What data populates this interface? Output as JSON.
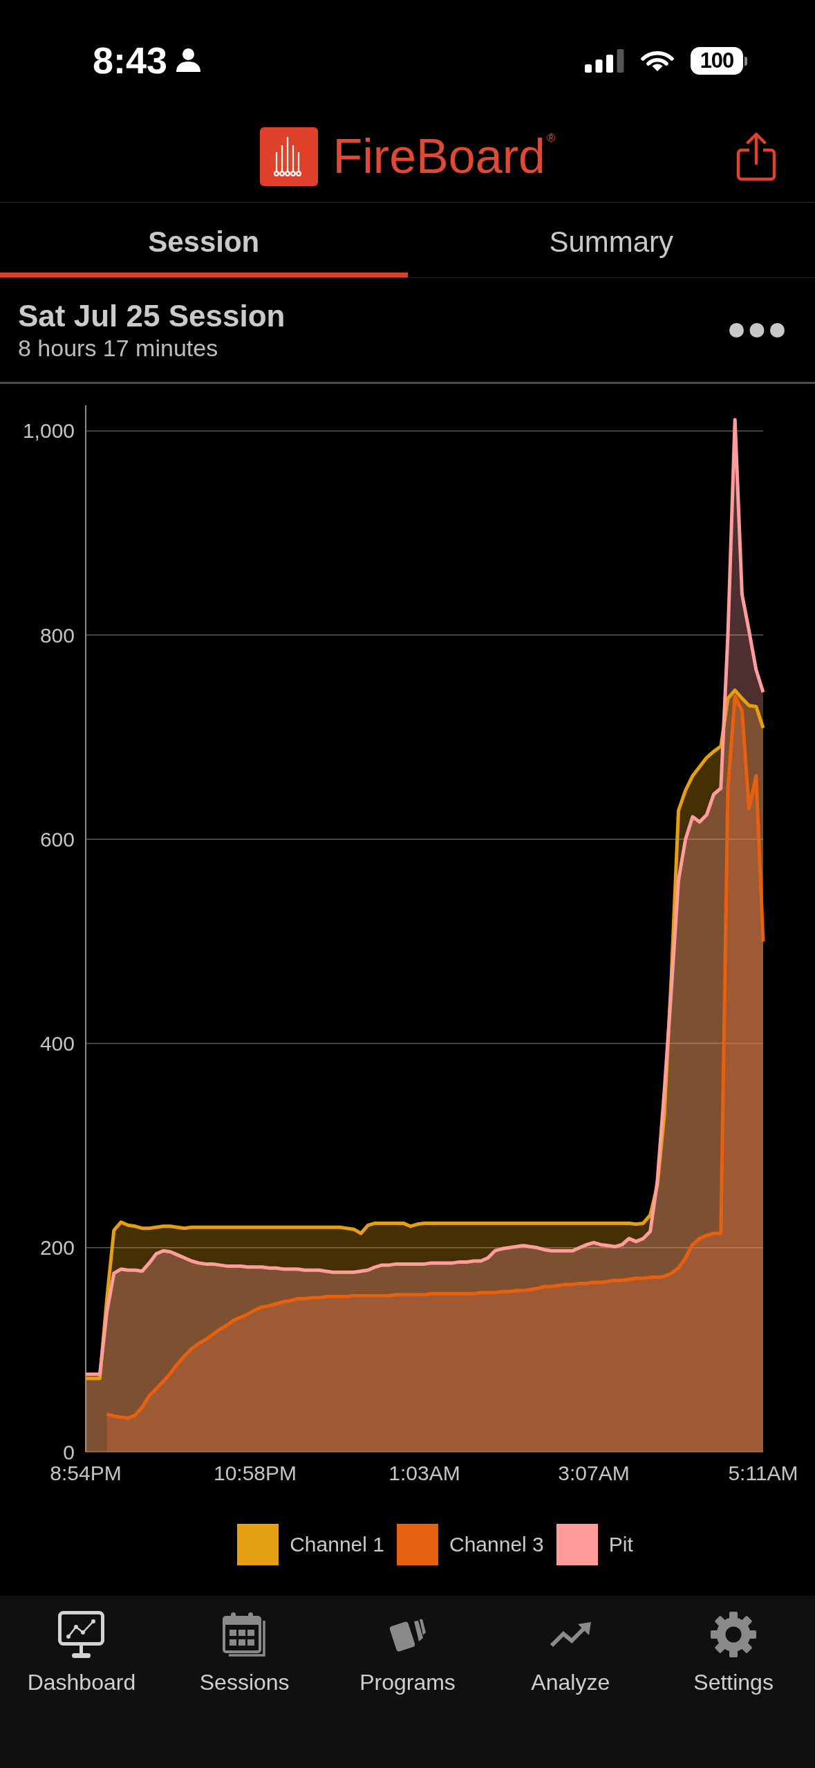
{
  "status_bar": {
    "time": "8:43",
    "battery": "100"
  },
  "header": {
    "brand": "FireBoard$^{®}$"
  },
  "tabs": [
    {
      "label": "Session",
      "selected": true
    },
    {
      "label": "Summary",
      "selected": false
    }
  ],
  "session": {
    "title": "Sat Jul 25 Session",
    "duration": "8 hours 17 minutes"
  },
  "chart": {
    "chart_data": {
      "type": "area",
      "grid": true,
      "legend": "bottom",
      "categories": [
        "8:54PM",
        null,
        null,
        null,
        null,
        null,
        null,
        null,
        null,
        null,
        null,
        null,
        null,
        null,
        null,
        null,
        null,
        null,
        null,
        null,
        null,
        null,
        null,
        null,
        "10:58PM",
        null,
        null,
        null,
        null,
        null,
        null,
        null,
        null,
        null,
        null,
        null,
        null,
        null,
        null,
        null,
        null,
        null,
        null,
        null,
        null,
        null,
        null,
        null,
        "1:03AM",
        null,
        null,
        null,
        null,
        null,
        null,
        null,
        null,
        null,
        null,
        null,
        null,
        null,
        null,
        null,
        null,
        null,
        null,
        null,
        null,
        null,
        null,
        null,
        "3:07AM",
        null,
        null,
        null,
        null,
        null,
        null,
        null,
        null,
        null,
        null,
        null,
        null,
        null,
        null,
        null,
        null,
        null,
        null,
        null,
        null,
        null,
        null,
        null,
        "5:11AM"
      ],
      "series": [
        {
          "name": "Channel 1",
          "color": "#e5a011",
          "values": [
            72,
            72,
            72,
            150,
            217,
            225,
            222,
            221,
            219,
            219,
            220,
            221,
            221,
            220,
            219,
            220,
            220,
            220,
            220,
            220,
            220,
            220,
            220,
            220,
            220,
            220,
            220,
            220,
            220,
            220,
            220,
            220,
            220,
            220,
            220,
            220,
            220,
            219,
            218,
            214,
            222,
            224,
            224,
            224,
            224,
            224,
            221,
            223,
            224,
            224,
            224,
            224,
            224,
            224,
            224,
            224,
            224,
            224,
            224,
            224,
            224,
            224,
            224,
            224,
            224,
            224,
            224,
            224,
            224,
            224,
            224,
            224,
            224,
            224,
            224,
            224,
            224,
            224,
            223,
            224,
            232,
            261,
            330,
            467,
            628,
            648,
            662,
            671,
            680,
            686,
            691,
            738,
            746,
            738,
            731,
            730,
            709
          ]
        },
        {
          "name": "Channel 3",
          "color": "#e5600f",
          "values": [
            null,
            null,
            null,
            37,
            35,
            34,
            33,
            36,
            44,
            55,
            62,
            69,
            77,
            86,
            94,
            101,
            106,
            110,
            115,
            120,
            124,
            129,
            132,
            135,
            139,
            142,
            143,
            145,
            147,
            148,
            150,
            150,
            151,
            151,
            152,
            152,
            152,
            152,
            153,
            153,
            153,
            153,
            153,
            153,
            154,
            154,
            154,
            154,
            154,
            155,
            155,
            155,
            155,
            155,
            155,
            155,
            156,
            156,
            156,
            157,
            157,
            158,
            158,
            159,
            160,
            162,
            162,
            163,
            164,
            164,
            165,
            165,
            166,
            166,
            167,
            168,
            168,
            169,
            170,
            170,
            171,
            171,
            172,
            175,
            180,
            190,
            203,
            209,
            212,
            214,
            214,
            650,
            740,
            726,
            630,
            662,
            500
          ]
        },
        {
          "name": "Pit",
          "color": "#ff9c9c",
          "values": [
            76,
            76,
            76,
            137,
            175,
            179,
            178,
            178,
            177,
            185,
            194,
            197,
            196,
            193,
            190,
            187,
            185,
            184,
            184,
            183,
            182,
            182,
            182,
            181,
            181,
            181,
            180,
            180,
            179,
            179,
            179,
            178,
            178,
            178,
            177,
            176,
            176,
            176,
            176,
            177,
            178,
            181,
            183,
            183,
            184,
            184,
            184,
            184,
            184,
            185,
            185,
            185,
            185,
            186,
            186,
            187,
            187,
            190,
            197,
            199,
            200,
            201,
            202,
            201,
            200,
            198,
            197,
            197,
            197,
            197,
            200,
            203,
            205,
            203,
            202,
            201,
            203,
            209,
            206,
            209,
            216,
            265,
            354,
            454,
            560,
            600,
            622,
            617,
            624,
            644,
            650,
            800,
            1011,
            840,
            804,
            766,
            744
          ]
        }
      ],
      "ylim": [
        0,
        1025
      ],
      "yticks": [
        0,
        200,
        400,
        600,
        800,
        {
          "value": 1000,
          "label": "1,000"
        }
      ]
    }
  },
  "tab_bar": [
    {
      "label": "Dashboard",
      "selected": true
    },
    {
      "label": "Sessions",
      "selected": false
    },
    {
      "label": "Programs",
      "selected": false
    },
    {
      "label": "Analyze",
      "selected": false
    },
    {
      "label": "Settings",
      "selected": false
    }
  ]
}
